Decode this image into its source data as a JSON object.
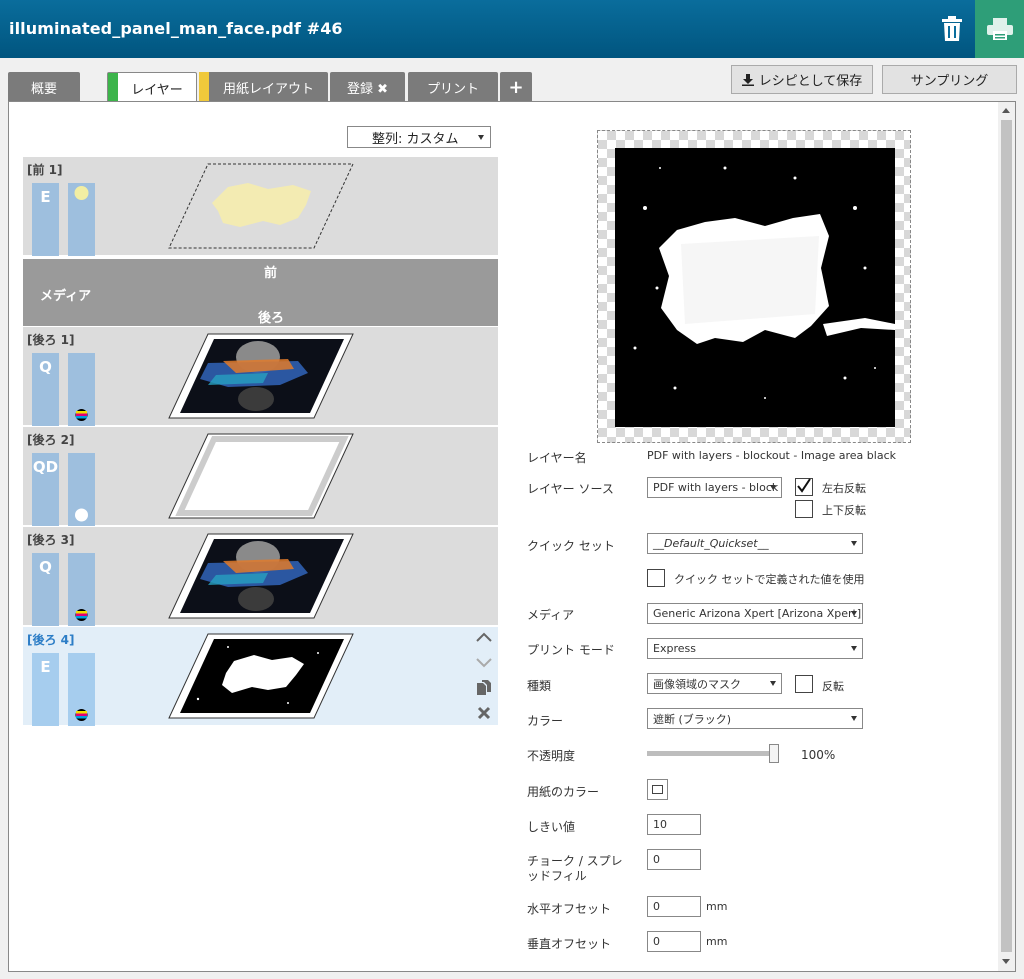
{
  "window": {
    "title": "illuminated_panel_man_face.pdf #46"
  },
  "tabs": [
    {
      "label": "概要"
    },
    {
      "label": "レイヤー"
    },
    {
      "label": "用紙レイアウト"
    },
    {
      "label": "登録 ✖"
    },
    {
      "label": "プリント"
    },
    {
      "label": "+"
    }
  ],
  "header_buttons": {
    "save_recipe": "レシピとして保存",
    "sampling": "サンプリング"
  },
  "sort": {
    "label": "整列: カスタム"
  },
  "layers": [
    {
      "name": "[前 1]",
      "code": "E"
    },
    {
      "name": "[後ろ 1]",
      "code": "Q"
    },
    {
      "name": "[後ろ 2]",
      "code": "QD"
    },
    {
      "name": "[後ろ 3]",
      "code": "Q"
    },
    {
      "name": "[後ろ 4]",
      "code": "E"
    }
  ],
  "media_bar": {
    "front": "前",
    "media": "メディア",
    "back": "後ろ"
  },
  "props": {
    "layer_name": {
      "label": "レイヤー名",
      "value": "PDF with layers - blockout - Image area black"
    },
    "layer_source": {
      "label": "レイヤー ソース",
      "value": "PDF with layers - block"
    },
    "flip_h": {
      "label": "左右反転",
      "checked": true
    },
    "flip_v": {
      "label": "上下反転",
      "checked": false
    },
    "quickset": {
      "label": "クイック セット",
      "value": "__Default_Quickset__"
    },
    "use_quickset": {
      "label": "クイック セットで定義された値を使用",
      "checked": false
    },
    "media": {
      "label": "メディア",
      "value": "Generic Arizona Xpert [Arizona Xpert]"
    },
    "print_mode": {
      "label": "プリント モード",
      "value": "Express"
    },
    "type": {
      "label": "種類",
      "value": "画像領域のマスク"
    },
    "invert": {
      "label": "反転",
      "checked": false
    },
    "color": {
      "label": "カラー",
      "value": "遮断 (ブラック)"
    },
    "opacity": {
      "label": "不透明度",
      "value": "100%",
      "level": 1.0
    },
    "paper_color": {
      "label": "用紙のカラー"
    },
    "threshold": {
      "label": "しきい値",
      "value": "10"
    },
    "choke_spread_1": {
      "label": "チョーク / スプレ"
    },
    "choke_spread_2": {
      "label": "ッドフィル",
      "value": "0"
    },
    "h_offset": {
      "label": "水平オフセット",
      "value": "0",
      "unit": "mm"
    },
    "v_offset": {
      "label": "垂直オフセット",
      "value": "0",
      "unit": "mm"
    }
  },
  "colors": {
    "titlebar": "#00557f",
    "print_button": "#2e9e78",
    "layers_tab_marker": "#3cb44a",
    "paper_tab_marker": "#f0c93b",
    "layer_column": "#9ebfde"
  }
}
